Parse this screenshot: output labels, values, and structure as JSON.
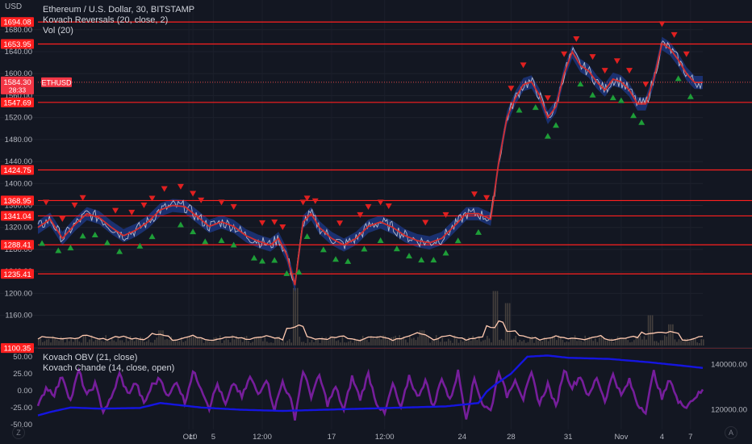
{
  "currency": "USD",
  "legend": {
    "symbol": "Ethereum / U.S. Dollar, 30, BITSTAMP",
    "indicator1": "Kovach Reversals (20, close, 2)",
    "indicator2": "Vol (20)",
    "osc1": "Kovach OBV (21, close)",
    "osc2": "Kovach Chande (14, close, open)"
  },
  "buttons": {
    "left": "Z",
    "right": "A"
  },
  "colors": {
    "price": "#d1d4dc",
    "hline": "#ff1f1f",
    "up": "#1e9e38",
    "down": "#e02020",
    "band": "#1e3a8a",
    "chande": "#7b1fa2",
    "obv": "#1515e0",
    "vol": "#ffc9b0"
  },
  "chart_data": [
    {
      "type": "line",
      "title": "Ethereum / U.S. Dollar, 30, BITSTAMP",
      "x_ticks": [
        "Oct",
        "5",
        "10",
        "12:00",
        "17",
        "12:00",
        "24",
        "28",
        "31",
        "Nov",
        "4",
        "7"
      ],
      "y_ticks": [
        1160,
        1200,
        1240,
        1280,
        1320,
        1360,
        1400,
        1440,
        1480,
        1520,
        1560,
        1600,
        1640,
        1680
      ],
      "y_tick_labels": [
        "1160.00",
        "1200.00",
        "1240.00",
        "1280.00",
        "1320.00",
        "1360.00",
        "1400.00",
        "1440.00",
        "1480.00",
        "1520.00",
        "1560.00",
        "1600.00",
        "1640.00",
        "1680.00"
      ],
      "ylim": [
        1105,
        1715
      ],
      "horizontal_levels": [
        {
          "value": 1694.08,
          "label": "1694.08"
        },
        {
          "value": 1653.95,
          "label": "1653.95"
        },
        {
          "value": 1547.69,
          "label": "1547.69"
        },
        {
          "value": 1424.75,
          "label": "1424.75"
        },
        {
          "value": 1368.95,
          "label": "1368.95"
        },
        {
          "value": 1341.04,
          "label": "1341.04"
        },
        {
          "value": 1288.41,
          "label": "1288.41"
        },
        {
          "value": 1235.41,
          "label": "1235.41"
        },
        {
          "value": 1100.35,
          "label": "1100.35"
        }
      ],
      "last_price": {
        "value": 1584.3,
        "label": "1584.30",
        "countdown": "28:33",
        "symbol": "ETHUSD"
      },
      "price_path": [
        {
          "x": 0,
          "y": 1320
        },
        {
          "x": 3,
          "y": 1335
        },
        {
          "x": 6,
          "y": 1300
        },
        {
          "x": 9,
          "y": 1325
        },
        {
          "x": 12,
          "y": 1345
        },
        {
          "x": 15,
          "y": 1338
        },
        {
          "x": 18,
          "y": 1320
        },
        {
          "x": 21,
          "y": 1305
        },
        {
          "x": 24,
          "y": 1315
        },
        {
          "x": 27,
          "y": 1330
        },
        {
          "x": 30,
          "y": 1352
        },
        {
          "x": 33,
          "y": 1360
        },
        {
          "x": 36,
          "y": 1358
        },
        {
          "x": 39,
          "y": 1340
        },
        {
          "x": 42,
          "y": 1322
        },
        {
          "x": 45,
          "y": 1330
        },
        {
          "x": 48,
          "y": 1322
        },
        {
          "x": 51,
          "y": 1305
        },
        {
          "x": 54,
          "y": 1295
        },
        {
          "x": 57,
          "y": 1288
        },
        {
          "x": 59,
          "y": 1300
        },
        {
          "x": 61,
          "y": 1270
        },
        {
          "x": 63,
          "y": 1215
        },
        {
          "x": 65,
          "y": 1330
        },
        {
          "x": 67,
          "y": 1345
        },
        {
          "x": 69,
          "y": 1320
        },
        {
          "x": 72,
          "y": 1300
        },
        {
          "x": 75,
          "y": 1288
        },
        {
          "x": 78,
          "y": 1300
        },
        {
          "x": 81,
          "y": 1322
        },
        {
          "x": 84,
          "y": 1330
        },
        {
          "x": 87,
          "y": 1320
        },
        {
          "x": 90,
          "y": 1305
        },
        {
          "x": 93,
          "y": 1296
        },
        {
          "x": 96,
          "y": 1292
        },
        {
          "x": 99,
          "y": 1300
        },
        {
          "x": 102,
          "y": 1322
        },
        {
          "x": 105,
          "y": 1345
        },
        {
          "x": 108,
          "y": 1345
        },
        {
          "x": 111,
          "y": 1335
        },
        {
          "x": 113,
          "y": 1440
        },
        {
          "x": 115,
          "y": 1520
        },
        {
          "x": 117,
          "y": 1555
        },
        {
          "x": 119,
          "y": 1580
        },
        {
          "x": 121,
          "y": 1585
        },
        {
          "x": 123,
          "y": 1560
        },
        {
          "x": 125,
          "y": 1520
        },
        {
          "x": 127,
          "y": 1540
        },
        {
          "x": 129,
          "y": 1600
        },
        {
          "x": 131,
          "y": 1640
        },
        {
          "x": 133,
          "y": 1615
        },
        {
          "x": 135,
          "y": 1605
        },
        {
          "x": 137,
          "y": 1585
        },
        {
          "x": 139,
          "y": 1570
        },
        {
          "x": 141,
          "y": 1590
        },
        {
          "x": 143,
          "y": 1585
        },
        {
          "x": 145,
          "y": 1570
        },
        {
          "x": 147,
          "y": 1545
        },
        {
          "x": 149,
          "y": 1545
        },
        {
          "x": 151,
          "y": 1590
        },
        {
          "x": 153,
          "y": 1655
        },
        {
          "x": 155,
          "y": 1645
        },
        {
          "x": 157,
          "y": 1625
        },
        {
          "x": 159,
          "y": 1600
        },
        {
          "x": 161,
          "y": 1584
        }
      ],
      "bullish_signals": [
        1,
        5,
        8,
        11,
        14,
        17,
        20,
        25,
        28,
        35,
        38,
        41,
        45,
        48,
        53,
        55,
        58,
        61,
        64,
        66,
        70,
        73,
        76,
        80,
        84,
        88,
        91,
        94,
        97,
        100,
        103,
        108,
        118,
        122,
        125,
        127,
        133,
        136,
        141,
        143,
        146,
        148,
        157,
        160
      ],
      "bearish_signals": [
        2,
        6,
        9,
        11,
        19,
        23,
        26,
        28,
        31,
        35,
        38,
        40,
        45,
        48,
        55,
        58,
        60,
        65,
        66,
        68,
        74,
        79,
        81,
        84,
        86,
        95,
        100,
        107,
        110,
        116,
        119,
        125,
        129,
        132,
        136,
        139,
        142,
        145,
        149,
        153,
        156,
        159
      ],
      "volume_pane_label": "Vol (20)",
      "volume_spikes": [
        {
          "x": 63,
          "v": 0.95
        },
        {
          "x": 112,
          "v": 0.9
        },
        {
          "x": 115,
          "v": 0.7
        },
        {
          "x": 150,
          "v": 0.5
        },
        {
          "x": 155,
          "v": 0.35
        },
        {
          "x": 30,
          "v": 0.25
        },
        {
          "x": 94,
          "v": 0.25
        }
      ]
    },
    {
      "type": "line",
      "title": "",
      "series": [
        {
          "name": "Kovach OBV (21, close)",
          "axis": "right",
          "y_ticks": [
            120000,
            140000
          ],
          "y_tick_labels": [
            "120000.00",
            "140000.00"
          ],
          "ylim": [
            112000,
            147000
          ],
          "values": [
            {
              "x": 0,
              "y": 117500
            },
            {
              "x": 3,
              "y": 119000
            },
            {
              "x": 8,
              "y": 121000
            },
            {
              "x": 15,
              "y": 120500
            },
            {
              "x": 25,
              "y": 120800
            },
            {
              "x": 30,
              "y": 123000
            },
            {
              "x": 40,
              "y": 121000
            },
            {
              "x": 50,
              "y": 120000
            },
            {
              "x": 60,
              "y": 119500
            },
            {
              "x": 70,
              "y": 120000
            },
            {
              "x": 80,
              "y": 120500
            },
            {
              "x": 90,
              "y": 121000
            },
            {
              "x": 100,
              "y": 121500
            },
            {
              "x": 108,
              "y": 123000
            },
            {
              "x": 110,
              "y": 128000
            },
            {
              "x": 112,
              "y": 131000
            },
            {
              "x": 116,
              "y": 136000
            },
            {
              "x": 120,
              "y": 143500
            },
            {
              "x": 125,
              "y": 144000
            },
            {
              "x": 130,
              "y": 143000
            },
            {
              "x": 140,
              "y": 142500
            },
            {
              "x": 150,
              "y": 141000
            },
            {
              "x": 158,
              "y": 139500
            },
            {
              "x": 163,
              "y": 138500
            }
          ]
        },
        {
          "name": "Kovach Chande (14, close, open)",
          "axis": "left",
          "y_ticks": [
            50,
            25,
            0,
            -25,
            -50
          ],
          "y_tick_labels": [
            "50.00",
            "25.00",
            "0.00",
            "-25.00",
            "-50.00"
          ],
          "ylim": [
            -55,
            62
          ],
          "values": [
            {
              "x": 0,
              "y": -25
            },
            {
              "x": 2,
              "y": 5
            },
            {
              "x": 4,
              "y": -5
            },
            {
              "x": 6,
              "y": 22
            },
            {
              "x": 8,
              "y": -15
            },
            {
              "x": 10,
              "y": 30
            },
            {
              "x": 12,
              "y": -8
            },
            {
              "x": 14,
              "y": 10
            },
            {
              "x": 16,
              "y": -30
            },
            {
              "x": 18,
              "y": -12
            },
            {
              "x": 20,
              "y": 25
            },
            {
              "x": 22,
              "y": -5
            },
            {
              "x": 24,
              "y": 12
            },
            {
              "x": 26,
              "y": -20
            },
            {
              "x": 28,
              "y": 8
            },
            {
              "x": 30,
              "y": 18
            },
            {
              "x": 32,
              "y": -10
            },
            {
              "x": 34,
              "y": 15
            },
            {
              "x": 36,
              "y": -18
            },
            {
              "x": 38,
              "y": 28
            },
            {
              "x": 40,
              "y": 5
            },
            {
              "x": 42,
              "y": -25
            },
            {
              "x": 44,
              "y": 10
            },
            {
              "x": 46,
              "y": -22
            },
            {
              "x": 48,
              "y": 12
            },
            {
              "x": 50,
              "y": -10
            },
            {
              "x": 52,
              "y": 20
            },
            {
              "x": 54,
              "y": -5
            },
            {
              "x": 56,
              "y": 18
            },
            {
              "x": 58,
              "y": -28
            },
            {
              "x": 60,
              "y": 14
            },
            {
              "x": 62,
              "y": -15
            },
            {
              "x": 63,
              "y": -40
            },
            {
              "x": 65,
              "y": 30
            },
            {
              "x": 67,
              "y": -8
            },
            {
              "x": 69,
              "y": 22
            },
            {
              "x": 71,
              "y": -20
            },
            {
              "x": 73,
              "y": 5
            },
            {
              "x": 75,
              "y": -30
            },
            {
              "x": 77,
              "y": 20
            },
            {
              "x": 79,
              "y": -12
            },
            {
              "x": 81,
              "y": 25
            },
            {
              "x": 83,
              "y": -18
            },
            {
              "x": 85,
              "y": -35
            },
            {
              "x": 87,
              "y": 10
            },
            {
              "x": 89,
              "y": -28
            },
            {
              "x": 91,
              "y": 22
            },
            {
              "x": 93,
              "y": -10
            },
            {
              "x": 95,
              "y": 15
            },
            {
              "x": 97,
              "y": -25
            },
            {
              "x": 99,
              "y": 20
            },
            {
              "x": 101,
              "y": -15
            },
            {
              "x": 103,
              "y": 28
            },
            {
              "x": 105,
              "y": -40
            },
            {
              "x": 107,
              "y": 18
            },
            {
              "x": 109,
              "y": -20
            },
            {
              "x": 111,
              "y": -30
            },
            {
              "x": 113,
              "y": 30
            },
            {
              "x": 115,
              "y": -8
            },
            {
              "x": 117,
              "y": 18
            },
            {
              "x": 119,
              "y": -12
            },
            {
              "x": 121,
              "y": 25
            },
            {
              "x": 123,
              "y": -20
            },
            {
              "x": 125,
              "y": 10
            },
            {
              "x": 127,
              "y": -25
            },
            {
              "x": 129,
              "y": 32
            },
            {
              "x": 131,
              "y": 5
            },
            {
              "x": 133,
              "y": 22
            },
            {
              "x": 135,
              "y": -10
            },
            {
              "x": 137,
              "y": 20
            },
            {
              "x": 139,
              "y": -15
            },
            {
              "x": 141,
              "y": 25
            },
            {
              "x": 143,
              "y": -8
            },
            {
              "x": 145,
              "y": 15
            },
            {
              "x": 147,
              "y": -20
            },
            {
              "x": 149,
              "y": -30
            },
            {
              "x": 151,
              "y": 28
            },
            {
              "x": 153,
              "y": -12
            },
            {
              "x": 155,
              "y": 18
            },
            {
              "x": 157,
              "y": -18
            },
            {
              "x": 159,
              "y": -22
            },
            {
              "x": 161,
              "y": -10
            },
            {
              "x": 163,
              "y": 0
            }
          ]
        }
      ]
    }
  ]
}
